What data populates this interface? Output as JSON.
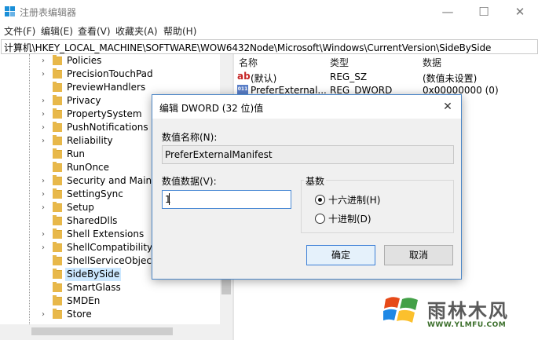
{
  "window": {
    "title": "注册表编辑器",
    "minimize_glyph": "—",
    "maximize_glyph": "☐",
    "close_glyph": "✕"
  },
  "menu": {
    "items": [
      "文件(F)",
      "编辑(E)",
      "查看(V)",
      "收藏夹(A)",
      "帮助(H)"
    ]
  },
  "address": {
    "path": "计算机\\HKEY_LOCAL_MACHINE\\SOFTWARE\\WOW6432Node\\Microsoft\\Windows\\CurrentVersion\\SideBySide"
  },
  "tree": {
    "items": [
      {
        "label": "Policies",
        "expandable": true
      },
      {
        "label": "PrecisionTouchPad",
        "expandable": true
      },
      {
        "label": "PreviewHandlers",
        "expandable": false
      },
      {
        "label": "Privacy",
        "expandable": true
      },
      {
        "label": "PropertySystem",
        "expandable": true
      },
      {
        "label": "PushNotifications",
        "expandable": true
      },
      {
        "label": "Reliability",
        "expandable": true
      },
      {
        "label": "Run",
        "expandable": false
      },
      {
        "label": "RunOnce",
        "expandable": false
      },
      {
        "label": "Security and Mainte",
        "expandable": true
      },
      {
        "label": "SettingSync",
        "expandable": true
      },
      {
        "label": "Setup",
        "expandable": true
      },
      {
        "label": "SharedDlls",
        "expandable": false
      },
      {
        "label": "Shell Extensions",
        "expandable": true
      },
      {
        "label": "ShellCompatibility",
        "expandable": true
      },
      {
        "label": "ShellServiceObjectD",
        "expandable": false
      },
      {
        "label": "SideBySide",
        "expandable": false,
        "selected": true
      },
      {
        "label": "SmartGlass",
        "expandable": false
      },
      {
        "label": "SMDEn",
        "expandable": false
      },
      {
        "label": "Store",
        "expandable": true
      }
    ]
  },
  "values": {
    "headers": {
      "name": "名称",
      "type": "类型",
      "data": "数据"
    },
    "rows": [
      {
        "name": "(默认)",
        "type": "REG_SZ",
        "data": "(数值未设置)",
        "icon": "string-value-icon"
      },
      {
        "name": "PreferExternal...",
        "type": "REG_DWORD",
        "data": "0x00000000 (0)",
        "icon": "binary-value-icon"
      }
    ]
  },
  "dialog": {
    "title": "编辑 DWORD (32 位)值",
    "value_name_label": "数值名称(N):",
    "value_name": "PreferExternalManifest",
    "value_data_label": "数值数据(V):",
    "value_data": "1",
    "base_label": "基数",
    "base_options": [
      {
        "label": "十六进制(H)",
        "selected": true
      },
      {
        "label": "十进制(D)",
        "selected": false
      }
    ],
    "ok_label": "确定",
    "cancel_label": "取消"
  },
  "watermark": {
    "brand": "雨林木风",
    "url": "WWW.YLMFU.COM"
  }
}
